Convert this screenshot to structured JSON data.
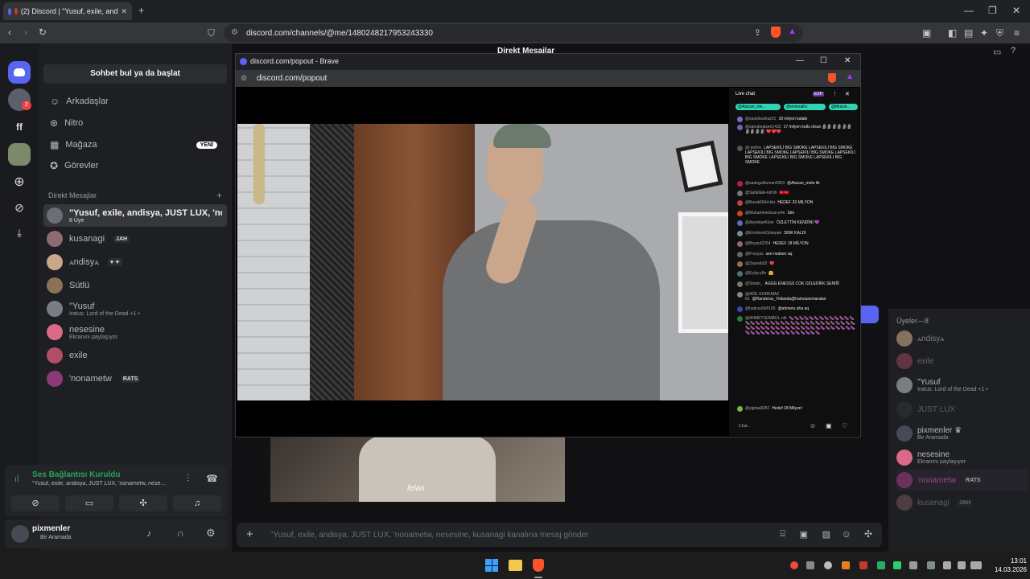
{
  "browser": {
    "tab_title": "(2) Discord | \"Yusuf, exile, and",
    "url": "discord.com/channels/@me/1480248217953243330"
  },
  "header": {
    "title": "Direkt Mesajlar"
  },
  "guilds": {
    "badge_count": "2",
    "ff_label": "ff"
  },
  "dm_panel": {
    "search_label": "Sohbet bul ya da başlat",
    "nav": [
      {
        "label": "Arkadaşlar"
      },
      {
        "label": "Nitro"
      },
      {
        "label": "Mağaza",
        "badge": "YENİ"
      },
      {
        "label": "Görevler"
      }
    ],
    "section_title": "Direkt Mesajlar",
    "dms": [
      {
        "name": "\"Yusuf, exile, andisya, JUST LUX, 'nona...",
        "sub": "8 Üye",
        "color": "#6b6e75"
      },
      {
        "name": "kusanagi",
        "tag": "JAH",
        "color": "#8e6b74"
      },
      {
        "name": "ꭺndisyꭺ",
        "tag": "♥ ✦",
        "color": "#c9a889"
      },
      {
        "name": "Sütlü",
        "color": "#8b7257"
      },
      {
        "name": "\"Yusuf",
        "sub": "Iratus: Lord of the Dead +1 •",
        "color": "#7a7d83"
      },
      {
        "name": "nesesine",
        "sub": "Ekranını paylaşıyor",
        "color": "#d96a8a"
      },
      {
        "name": "exile",
        "color": "#b34e68"
      },
      {
        "name": "'nonametw",
        "tag": "RATS",
        "color": "#8a3a78"
      }
    ]
  },
  "voice": {
    "status": "Ses Bağlantısı Kuruldu",
    "channel": "\"Yusuf, exile, andisya, JUST LUX, 'nonametw, nese...",
    "status_color": "#23a55a"
  },
  "user": {
    "name": "pixmenler",
    "status": "Bir Aramada"
  },
  "members": {
    "title": "Üyeler—8",
    "items": [
      {
        "name": "ꭺndisyꭺ",
        "color": "#c9a889"
      },
      {
        "name": "exile",
        "color": "#b34e68"
      },
      {
        "name": "\"Yusuf",
        "sub": "Iratus: Lord of the Dead +1 •",
        "color": "#7a7d83"
      },
      {
        "name": "JUST LUX",
        "color": "#3a3c41"
      },
      {
        "name": "pixmenler ♛",
        "sub": "Bir Aramada",
        "color": "#474a54"
      },
      {
        "name": "nesesine",
        "sub": "Ekranını paylaşıyor",
        "color": "#d96a8a"
      },
      {
        "name": "'nonametw",
        "tag": "RATS",
        "color": "#8a3a78"
      },
      {
        "name": "kusanagi",
        "tag": "JAH",
        "color": "#8e6b74"
      }
    ]
  },
  "message_bar": {
    "placeholder": "\"Yusuf, exile, andisya, JUST LUX, 'nonametw, nesesine, kusanagi kanalına mesaj gönder"
  },
  "stream_caption": "felan",
  "popout": {
    "title": "discord.com/popout - Brave",
    "url": "discord.com/popout",
    "live_chat": {
      "title": "Live chat",
      "exp_label": "EXP",
      "chips": [
        "@Atacan_me...",
        "@emirsalhc",
        "@Mulsin..."
      ],
      "messages": [
        {
          "user": "@sasidosahaz01",
          "text": "18 milyon kalabi",
          "color": "#7b6cc1"
        },
        {
          "user": "@sanubeaizen1433",
          "text": "17 milyon kutlu olsun 🗿🗿🗿🗿🗿🗿🗿🗿🗿🗿 ❤️❤️❤️",
          "color": "#5e6ea8"
        },
        {
          "user": "@-pothix",
          "text": "LAPSEKİLİ BİG SMOKE LAPSEKİLİ BİG SMOKE LAPSEKİLİ BİG SMOKE LAPSEKİLİ BİG SMOKE LAPSEKİLİ BİG SMOKE LAPSEKİLİ BİG SMOKE LAPSEKİLİ BİG SMOKE",
          "color": "#555"
        },
        {
          "user": "@sadegulduman4303",
          "text": "@Atacan_mete ilk",
          "color": "#c2185b"
        },
        {
          "user": "@Safailiale-kdr9h",
          "text": "🇹🇷🇹🇷",
          "color": "#777"
        },
        {
          "user": "@Burak6664-tks",
          "text": "HEDEF 20 MİLYON",
          "color": "#c1443c"
        },
        {
          "user": "@Muhammedcan-p4n",
          "text": "Slm",
          "color": "#d84315"
        },
        {
          "user": "@AzeokanKizer",
          "text": "ÖZLETTİN KENDİNİ 💜",
          "color": "#5c6bc0"
        },
        {
          "user": "@EmirberkOzbepak",
          "text": "300K KALDI",
          "color": "#78909c"
        },
        {
          "user": "@Boysuf2254",
          "text": "HEDEF 18 MİLYON",
          "color": "#8e6b74"
        },
        {
          "user": "@Frozyss",
          "text": "sen nedsen aq",
          "color": "#666"
        },
        {
          "user": "@Zayneb33",
          "text": "❤️",
          "color": "#9c6b5a"
        },
        {
          "user": "@Eyüp-y9n",
          "text": "🤗",
          "color": "#546e7a"
        },
        {
          "user": "@Sowin_",
          "text": "AGGG ENESSS COK OZLEDİKK SENİİİİ",
          "color": "#777"
        },
        {
          "user": "@ADİL KORKMAZ 61",
          "text": "@Randeras_Yollanda@hamzasemaralan",
          "color": "#888"
        },
        {
          "user": "@hatices0b5195",
          "text": "@ahmetu aha aq",
          "color": "#3949ab"
        },
        {
          "user": "@AHMETSÜMBÜL-ntk",
          "text": "🍆🍆🍆🍆🍆🍆🍆🍆🍆🍆🍆🍆🍆🍆🍆🍆🍆🍆🍆🍆🍆🍆🍆🍆🍆🍆🍆🍆🍆🍆🍆🍆🍆🍆🍆🍆🍆🍆🍆🍆🍆🍆🍆🍆🍆🍆🍆🍆🍆🍆🍆🍆🍆🍆🍆🍆🍆🍆🍆🍆🍆🍆🍆🍆🍆🍆🍆🍆🍆🍆🍆🍆",
          "color": "#2e7d32"
        },
        {
          "user": "@yigitas8281",
          "text": "Hedef 18 Milyon!",
          "color": "#7cb342"
        }
      ],
      "input_placeholder": "Chat..."
    }
  },
  "taskbar": {
    "time": "13:01",
    "date": "14.03.2026"
  }
}
